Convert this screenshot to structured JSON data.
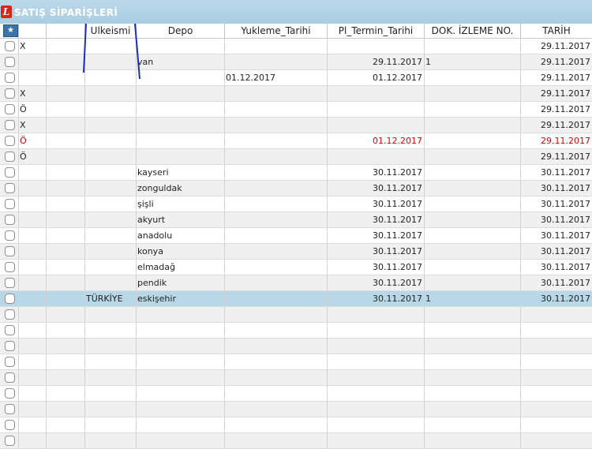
{
  "window": {
    "title": "SATIŞ SİPARİŞLERİ",
    "logo_letter": "L",
    "select_icon": "settings-star-icon"
  },
  "columns": [
    {
      "key": "sel",
      "label": ""
    },
    {
      "key": "col1",
      "label": ""
    },
    {
      "key": "col2",
      "label": ""
    },
    {
      "key": "ulke",
      "label": "Ulkeismi"
    },
    {
      "key": "depo",
      "label": "Depo"
    },
    {
      "key": "yukleme",
      "label": "Yukleme_Tarihi"
    },
    {
      "key": "termin",
      "label": "Pl_Termin_Tarihi"
    },
    {
      "key": "dok",
      "label": "DOK. İZLEME NO."
    },
    {
      "key": "tarih",
      "label": "TARİH"
    }
  ],
  "rows": [
    {
      "col1": "X",
      "col2": "",
      "ulke": "",
      "depo": "",
      "yukleme": "",
      "termin": "",
      "dok": "",
      "tarih": "29.11.2017",
      "red": false
    },
    {
      "col1": "",
      "col2": "",
      "ulke": "",
      "depo": "van",
      "yukleme": "",
      "termin": "29.11.2017",
      "dok": "1",
      "tarih": "29.11.2017",
      "red": false
    },
    {
      "col1": "",
      "col2": "",
      "ulke": "",
      "depo": "",
      "yukleme": "01.12.2017",
      "termin": "01.12.2017",
      "dok": "",
      "tarih": "29.11.2017",
      "red": false
    },
    {
      "col1": "X",
      "col2": "",
      "ulke": "",
      "depo": "",
      "yukleme": "",
      "termin": "",
      "dok": "",
      "tarih": "29.11.2017",
      "red": false
    },
    {
      "col1": "Ö",
      "col2": "",
      "ulke": "",
      "depo": "",
      "yukleme": "",
      "termin": "",
      "dok": "",
      "tarih": "29.11.2017",
      "red": false
    },
    {
      "col1": "X",
      "col2": "",
      "ulke": "",
      "depo": "",
      "yukleme": "",
      "termin": "",
      "dok": "",
      "tarih": "29.11.2017",
      "red": false
    },
    {
      "col1": "Ö",
      "col2": "",
      "ulke": "",
      "depo": "",
      "yukleme": "",
      "termin": "01.12.2017",
      "dok": "",
      "tarih": "29.11.2017",
      "red": true
    },
    {
      "col1": "Ö",
      "col2": "",
      "ulke": "",
      "depo": "",
      "yukleme": "",
      "termin": "",
      "dok": "",
      "tarih": "29.11.2017",
      "red": false
    },
    {
      "col1": "",
      "col2": "",
      "ulke": "",
      "depo": "kayseri",
      "yukleme": "",
      "termin": "30.11.2017",
      "dok": "",
      "tarih": "30.11.2017",
      "red": false
    },
    {
      "col1": "",
      "col2": "",
      "ulke": "",
      "depo": "zonguldak",
      "yukleme": "",
      "termin": "30.11.2017",
      "dok": "",
      "tarih": "30.11.2017",
      "red": false
    },
    {
      "col1": "",
      "col2": "",
      "ulke": "",
      "depo": "şişli",
      "yukleme": "",
      "termin": "30.11.2017",
      "dok": "",
      "tarih": "30.11.2017",
      "red": false
    },
    {
      "col1": "",
      "col2": "",
      "ulke": "",
      "depo": "akyurt",
      "yukleme": "",
      "termin": "30.11.2017",
      "dok": "",
      "tarih": "30.11.2017",
      "red": false
    },
    {
      "col1": "",
      "col2": "",
      "ulke": "",
      "depo": "anadolu",
      "yukleme": "",
      "termin": "30.11.2017",
      "dok": "",
      "tarih": "30.11.2017",
      "red": false
    },
    {
      "col1": "",
      "col2": "",
      "ulke": "",
      "depo": "konya",
      "yukleme": "",
      "termin": "30.11.2017",
      "dok": "",
      "tarih": "30.11.2017",
      "red": false
    },
    {
      "col1": "",
      "col2": "",
      "ulke": "",
      "depo": "elmadağ",
      "yukleme": "",
      "termin": "30.11.2017",
      "dok": "",
      "tarih": "30.11.2017",
      "red": false
    },
    {
      "col1": "",
      "col2": "",
      "ulke": "",
      "depo": "pendik",
      "yukleme": "",
      "termin": "30.11.2017",
      "dok": "",
      "tarih": "30.11.2017",
      "red": false
    },
    {
      "col1": "",
      "col2": "",
      "ulke": "TÜRKİYE",
      "depo": "eskişehir",
      "yukleme": "",
      "termin": "30.11.2017",
      "dok": "1",
      "tarih": "30.11.2017",
      "red": false,
      "selected": true
    }
  ],
  "empty_row_count": 9,
  "colors": {
    "title_bar": "#a9cde2",
    "selected_row": "#b8d8e8",
    "alt_row": "#f0f0f0",
    "red_text": "#d40000",
    "pen": "#1f2fb5"
  }
}
